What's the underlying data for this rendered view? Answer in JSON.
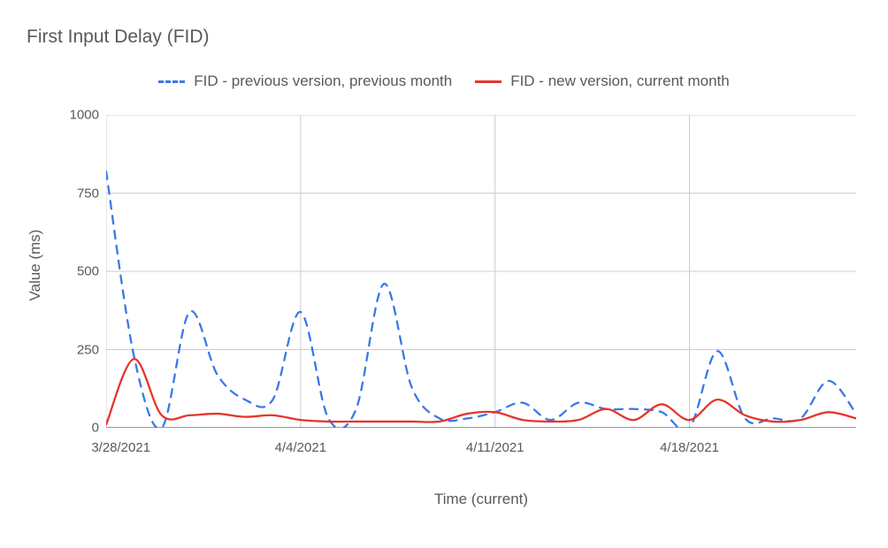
{
  "chart_data": {
    "type": "line",
    "title": "First Input Delay (FID)",
    "xlabel": "Time (current)",
    "ylabel": "Value (ms)",
    "ylim": [
      0,
      1000
    ],
    "y_ticks": [
      0,
      250,
      500,
      750,
      1000
    ],
    "x_tick_labels": [
      "3/28/2021",
      "4/4/2021",
      "4/11/2021",
      "4/18/2021"
    ],
    "x_tick_indices": [
      0,
      7,
      14,
      21
    ],
    "legend": [
      {
        "name": "FID - previous version, previous month",
        "color": "#3b78e7",
        "dash": true
      },
      {
        "name": "FID - new version, current month",
        "color": "#e6352b",
        "dash": false
      }
    ],
    "x": [
      0,
      1,
      2,
      3,
      4,
      5,
      6,
      7,
      8,
      9,
      10,
      11,
      12,
      13,
      14,
      15,
      16,
      17,
      18,
      19,
      20,
      21,
      22,
      23,
      24,
      25,
      26,
      27
    ],
    "series": [
      {
        "name": "FID - previous version, previous month",
        "values": [
          820,
          230,
          0,
          370,
          170,
          90,
          90,
          370,
          30,
          60,
          460,
          130,
          30,
          30,
          50,
          80,
          25,
          80,
          60,
          60,
          50,
          0,
          245,
          30,
          30,
          30,
          150,
          45
        ]
      },
      {
        "name": "FID - new version, current month",
        "values": [
          10,
          220,
          40,
          40,
          45,
          35,
          40,
          25,
          20,
          20,
          20,
          20,
          20,
          45,
          50,
          25,
          20,
          25,
          60,
          25,
          75,
          25,
          90,
          40,
          20,
          25,
          50,
          30
        ]
      }
    ]
  }
}
